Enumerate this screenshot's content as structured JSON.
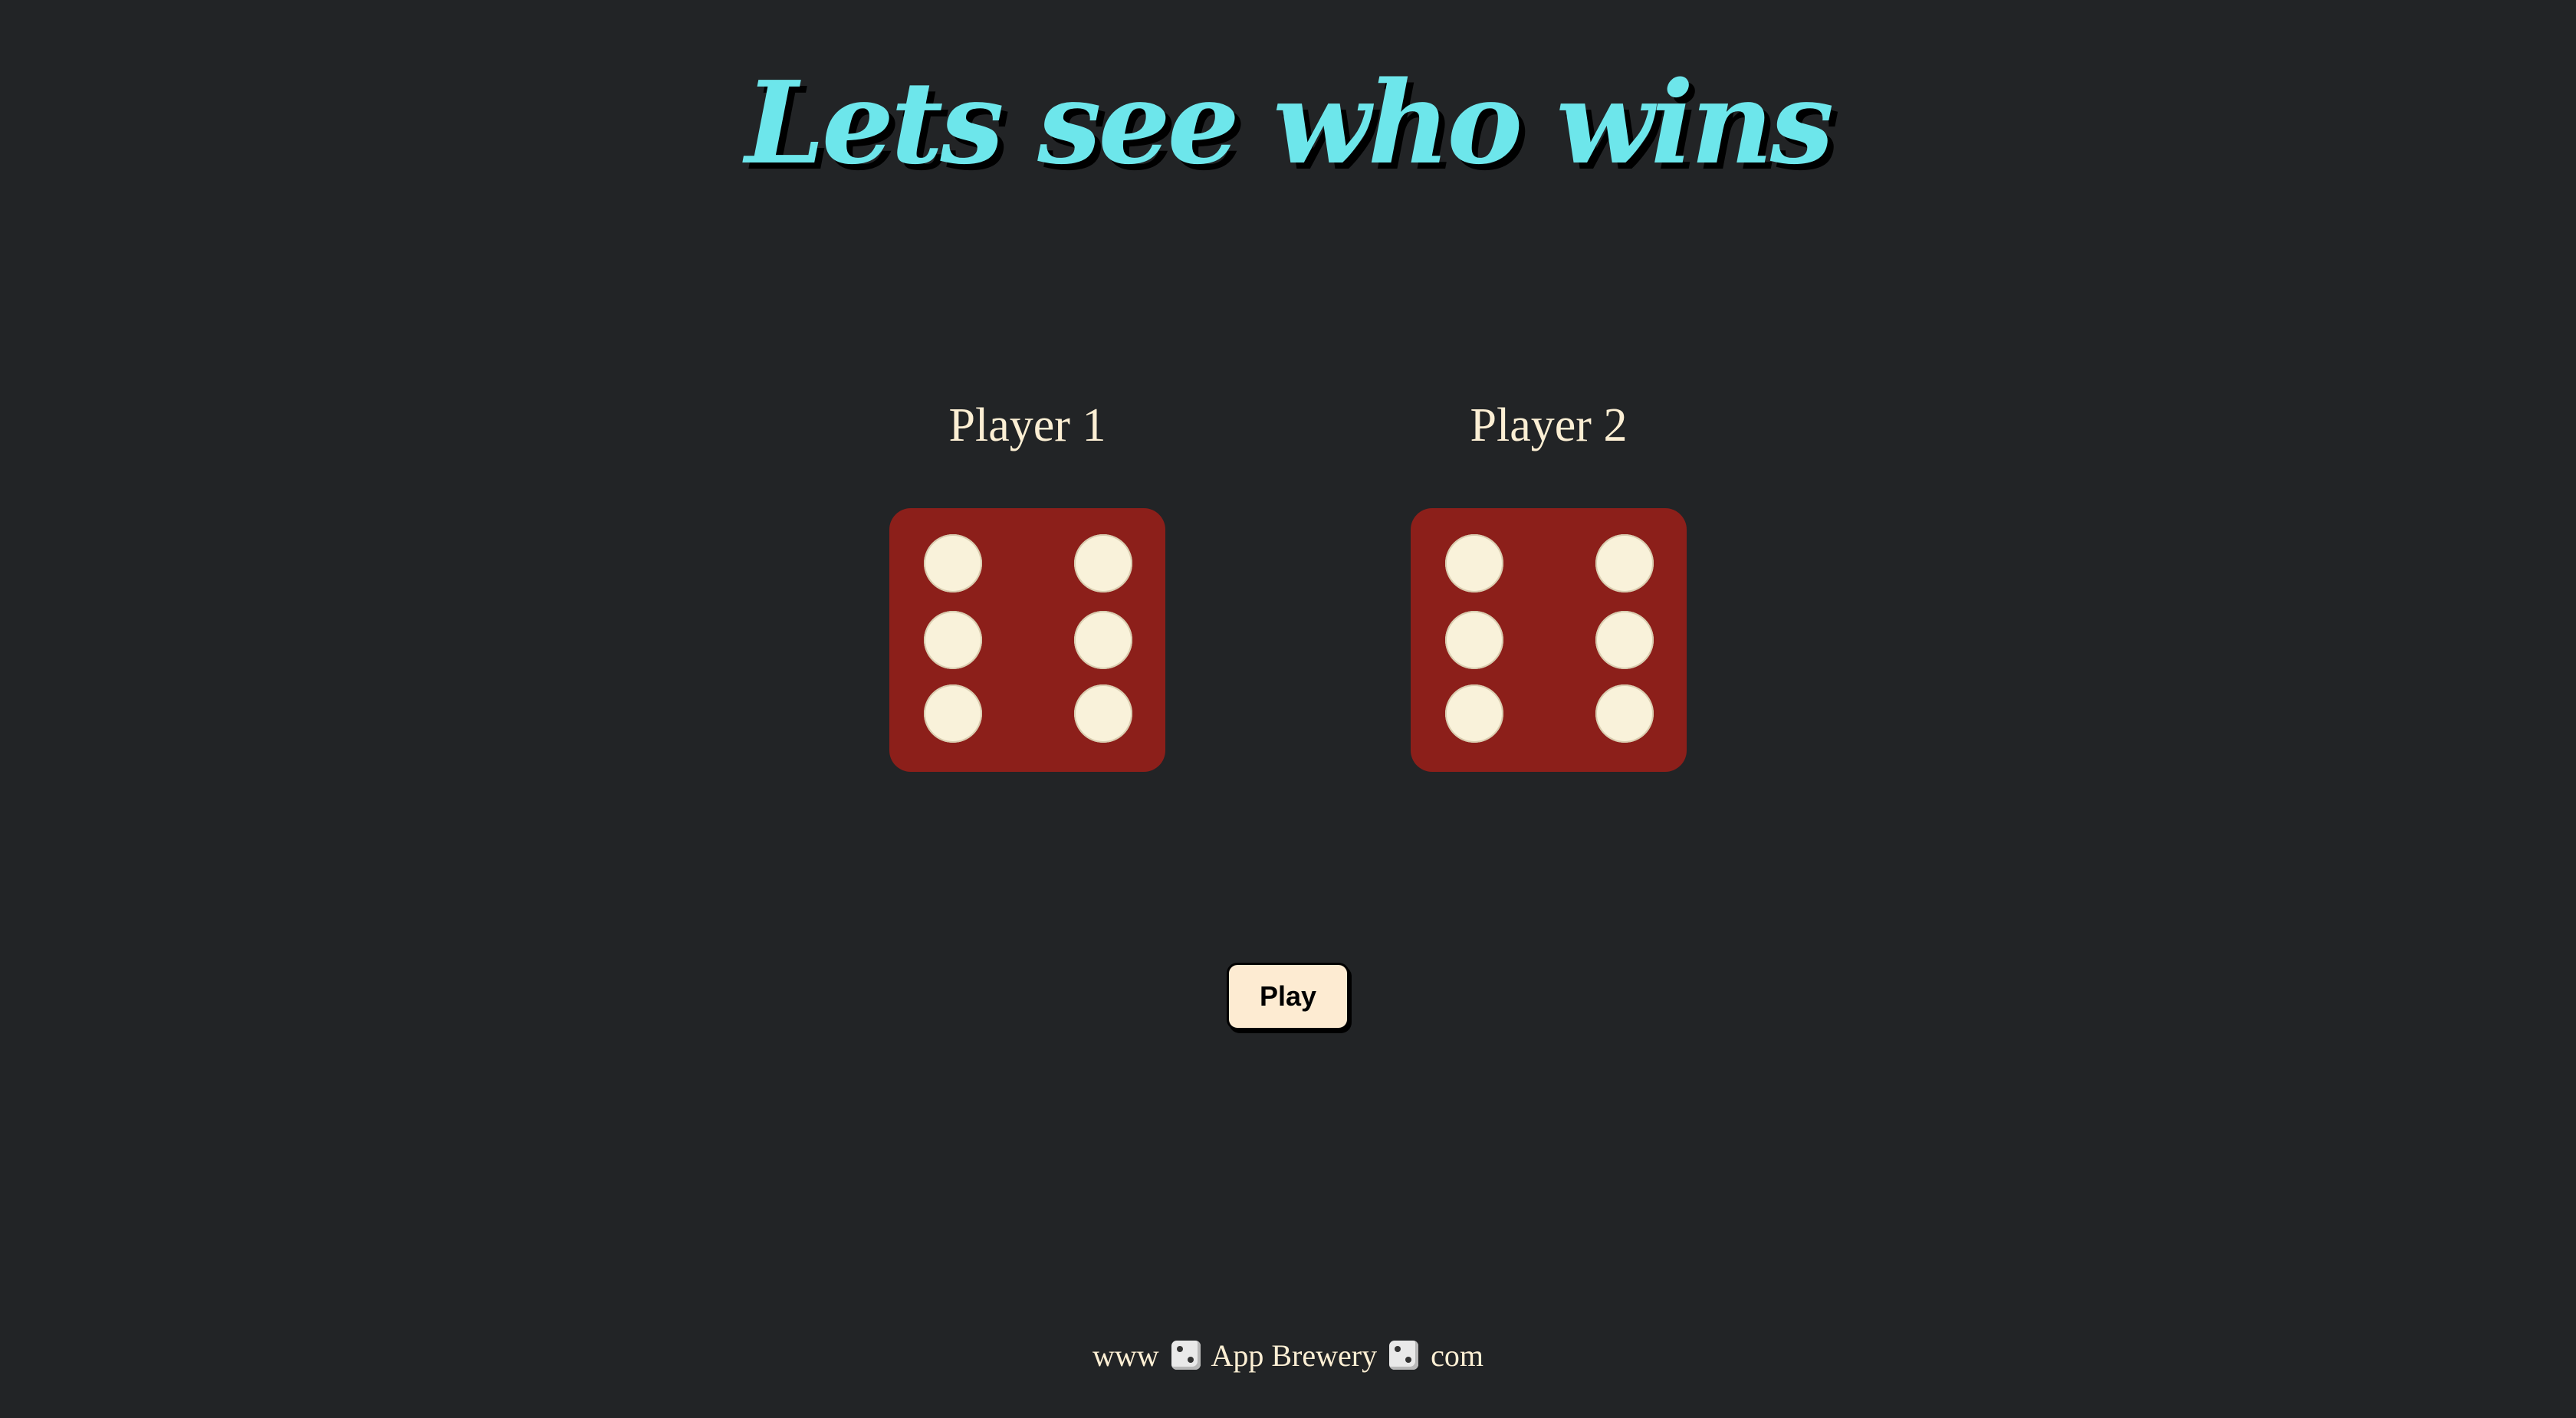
{
  "page": {
    "title": "Lets see who wins"
  },
  "players": [
    {
      "name": "Player 1",
      "die_value": 6
    },
    {
      "name": "Player 2",
      "die_value": 6
    }
  ],
  "controls": {
    "play_label": "Play"
  },
  "footer": {
    "part1": "www",
    "part2": "App Brewery",
    "part3": "com",
    "separator_icon": "game-die-icon"
  },
  "colors": {
    "background": "#222426",
    "title": "#6de6eb",
    "text": "#fcefd4",
    "die": "#8c1f1a",
    "pip": "#f9f2da",
    "button": "#fdebd2"
  }
}
